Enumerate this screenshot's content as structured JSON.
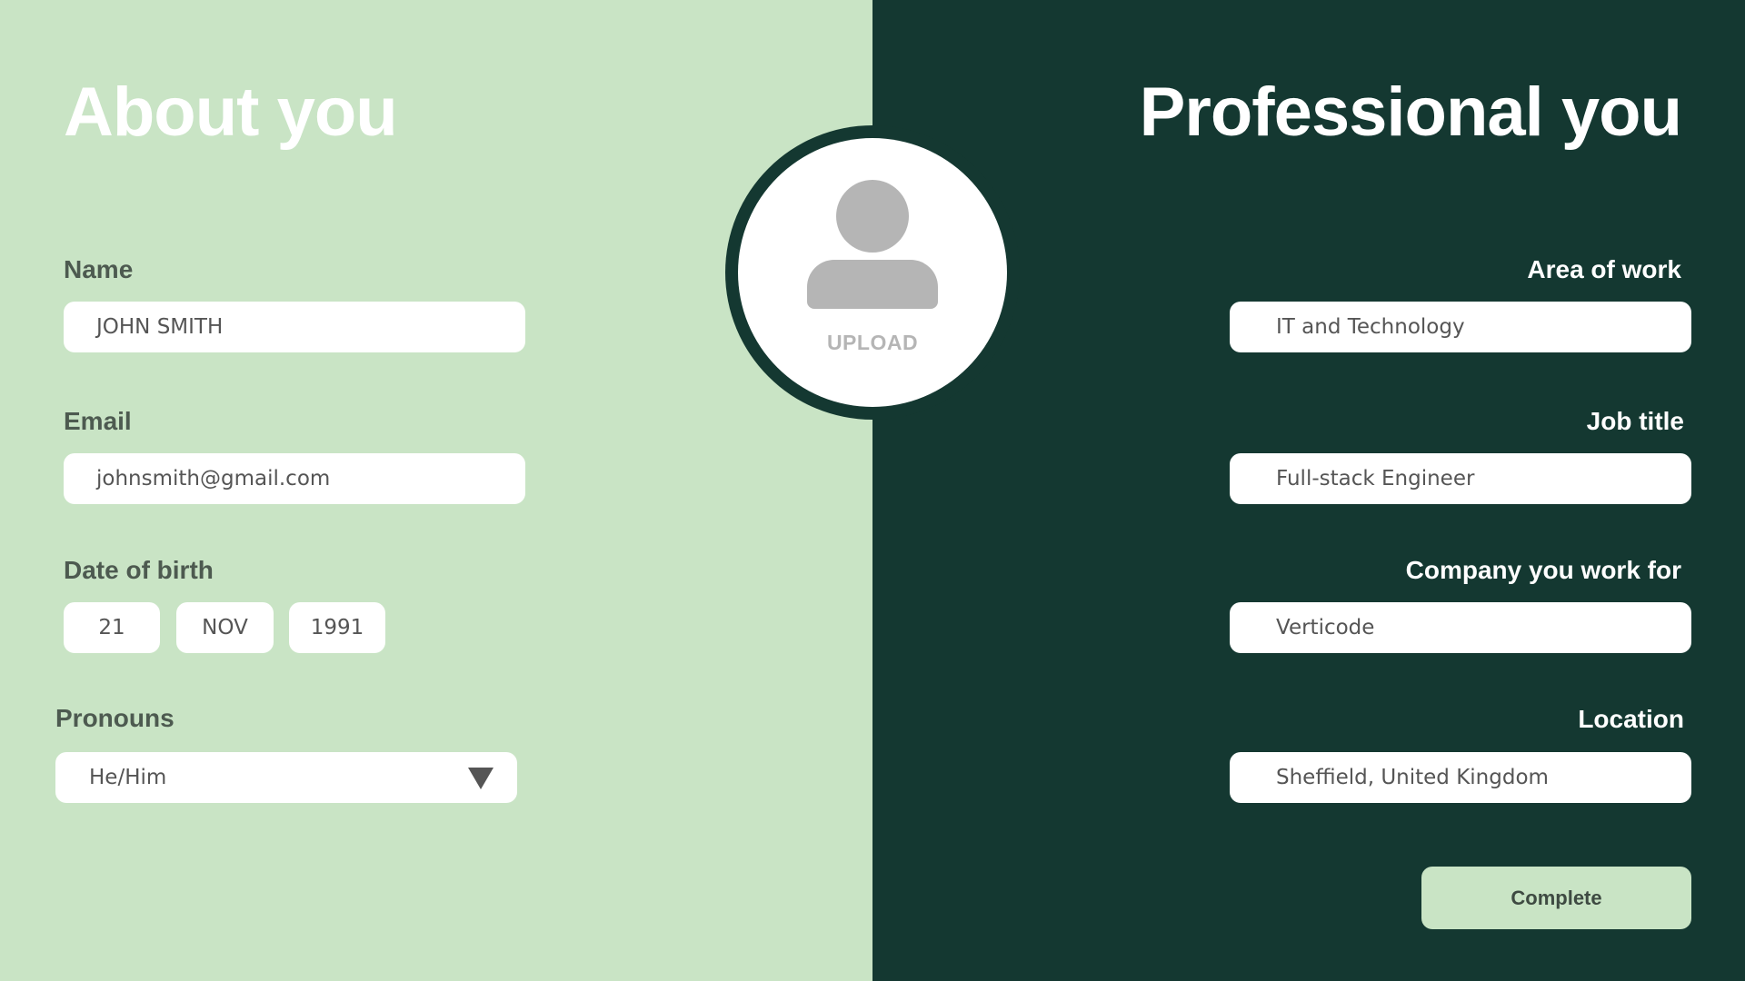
{
  "about": {
    "heading": "About you",
    "name": {
      "label": "Name",
      "value": "JOHN SMITH"
    },
    "email": {
      "label": "Email",
      "value": "johnsmith@gmail.com"
    },
    "dob": {
      "label": "Date of birth",
      "day": "21",
      "month": "NOV",
      "year": "1991"
    },
    "pronouns": {
      "label": "Pronouns",
      "value": "He/Him",
      "arrow_icon": "triangle-down"
    }
  },
  "avatar": {
    "icon": "user-silhouette",
    "upload_label": "UPLOAD"
  },
  "professional": {
    "heading": "Professional you",
    "area_of_work": {
      "label": "Area of work",
      "value": "IT and Technology"
    },
    "job_title": {
      "label": "Job title",
      "value": "Full-stack Engineer"
    },
    "company": {
      "label": "Company you work for",
      "value": "Verticode"
    },
    "location": {
      "label": "Location",
      "value": "Sheffield, United Kingdom"
    },
    "complete_label": "Complete"
  },
  "colors": {
    "light_green": "#c9e4c5",
    "dark_green": "#143831",
    "field_bg": "#ffffff",
    "placeholder_grey": "#b5b5b5"
  }
}
